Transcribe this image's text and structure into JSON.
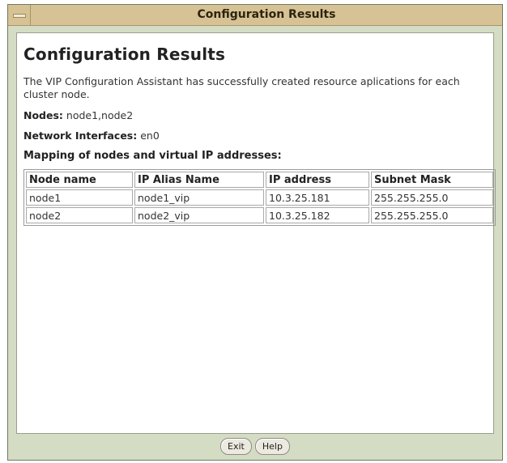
{
  "window": {
    "title": "Configuration Results"
  },
  "content": {
    "heading": "Configuration Results",
    "description": "The VIP Configuration Assistant has successfully created resource aplications for each cluster node.",
    "nodes_label": "Nodes:",
    "nodes_value": "node1,node2",
    "interfaces_label": "Network Interfaces:",
    "interfaces_value": "en0",
    "mapping_title": "Mapping of nodes and virtual IP addresses:"
  },
  "table": {
    "headers": [
      "Node name",
      "IP Alias Name",
      "IP address",
      "Subnet Mask"
    ],
    "rows": [
      [
        "node1",
        "node1_vip",
        "10.3.25.181",
        "255.255.255.0"
      ],
      [
        "node2",
        "node2_vip",
        "10.3.25.182",
        "255.255.255.0"
      ]
    ]
  },
  "buttons": {
    "exit_label": "Exit",
    "help_label": "Help"
  }
}
